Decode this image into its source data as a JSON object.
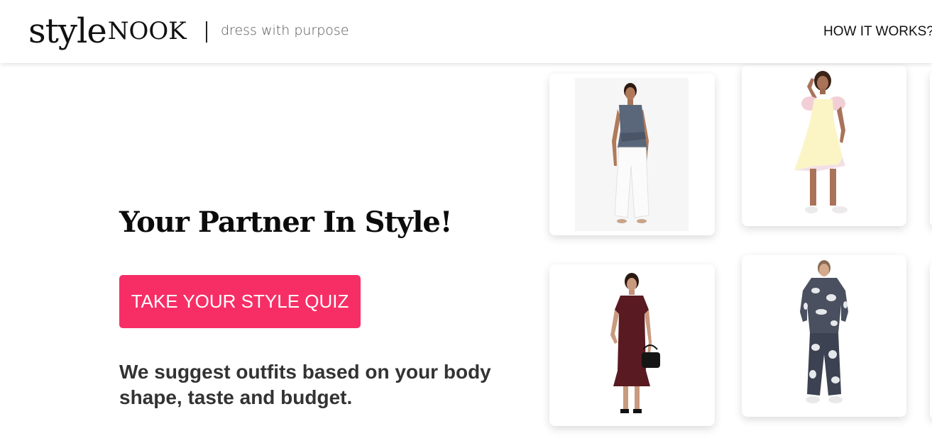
{
  "header": {
    "logo_style": "style",
    "logo_nook": "NOOK",
    "tagline": "dress with purpose",
    "nav_link": "HOW IT WORKS?"
  },
  "hero": {
    "title": "Your Partner In Style!",
    "cta_label": "TAKE YOUR STYLE QUIZ",
    "description": "We suggest outfits based on your body shape, taste and budget."
  },
  "colors": {
    "accent": "#f72e66",
    "text_dark": "#0b0b0b",
    "text_body": "#333333"
  },
  "products": [
    {
      "icon": "outfit-grey-top-white-trousers-icon"
    },
    {
      "icon": "outfit-yellow-pinafore-dress-icon"
    },
    {
      "icon": "outfit-maroon-dress-handbag-icon"
    },
    {
      "icon": "outfit-tie-dye-tracksuit-icon"
    }
  ]
}
